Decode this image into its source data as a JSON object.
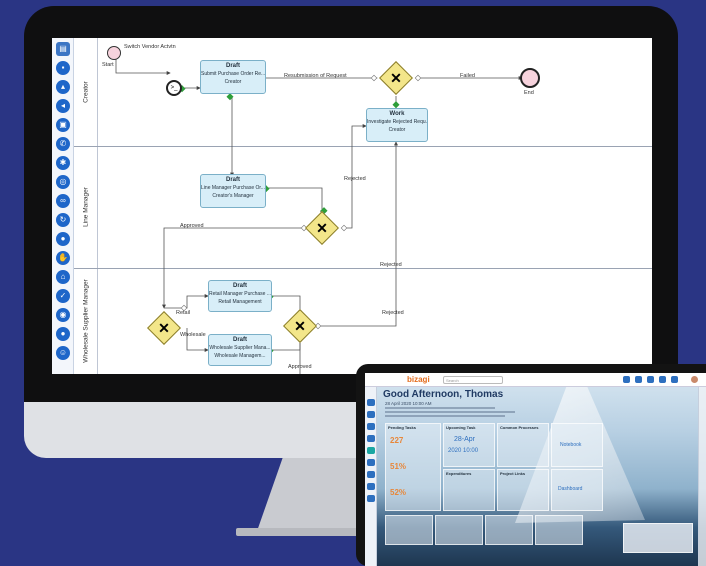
{
  "toolbar": {
    "tools": [
      "page-icon",
      "save-icon",
      "upload-icon",
      "export-icon",
      "clipboard-icon",
      "phone-icon",
      "settings-icon",
      "globe-icon",
      "link-icon",
      "refresh-icon",
      "location-icon",
      "hand-icon",
      "tag-icon",
      "check-icon",
      "lock-icon",
      "user-icon",
      "person-icon"
    ]
  },
  "diagram": {
    "lanes": [
      "Creator",
      "Line Manager",
      "Wholesale Supplier Manager"
    ],
    "start_label": "Start",
    "end_label": "End",
    "script_label": "Switch Vendor Actvtn",
    "tasks": [
      {
        "id": "t1",
        "title": "Draft",
        "name": "Submit Purchase Order Re...",
        "role": "Creator"
      },
      {
        "id": "t2",
        "title": "Draft",
        "name": "Line Manager Purchase Or...",
        "role": "Creator's Manager"
      },
      {
        "id": "t3",
        "title": "Work",
        "name": "Investigate Rejected Requ...",
        "role": "Creator"
      },
      {
        "id": "t4",
        "title": "Draft",
        "name": "Retail Manager Purchase ...",
        "role": "Retail Management"
      },
      {
        "id": "t5",
        "title": "Draft",
        "name": "Wholesale Supplier Mana...",
        "role": "Wholesale Managem..."
      }
    ],
    "flows": {
      "resubmission": "Resubmission of Request",
      "failed": "Failed",
      "rejected": "Rejected",
      "approved": "Approved",
      "retail": "Retail",
      "wholesale": "Wholesale"
    }
  },
  "tablet": {
    "logo": "bizagi",
    "search_placeholder": "Search",
    "greeting": "Good Afternoon, Thomas",
    "date_line": "28 April 2020  10:00 AM",
    "widgets": {
      "pending": {
        "title": "Pending Tasks",
        "value1": "227",
        "value2": "51%",
        "value3": "52%"
      },
      "upcoming": {
        "title": "Upcoming Task",
        "date": "28-Apr",
        "time": "2020 10:00"
      },
      "processes": {
        "title": "Common Processes",
        "link": "Notebook"
      },
      "expenses": {
        "title": "Expenditures"
      },
      "projects": {
        "title": "Project Links"
      },
      "dashboard": {
        "title": "Dashboard"
      }
    }
  },
  "colors": {
    "background": "#2a3584",
    "task_fill": "#d8eef8",
    "gateway_fill": "#f3e68a",
    "toolbar_icon": "#1e66c9",
    "connector_green": "#2e9e3a"
  }
}
